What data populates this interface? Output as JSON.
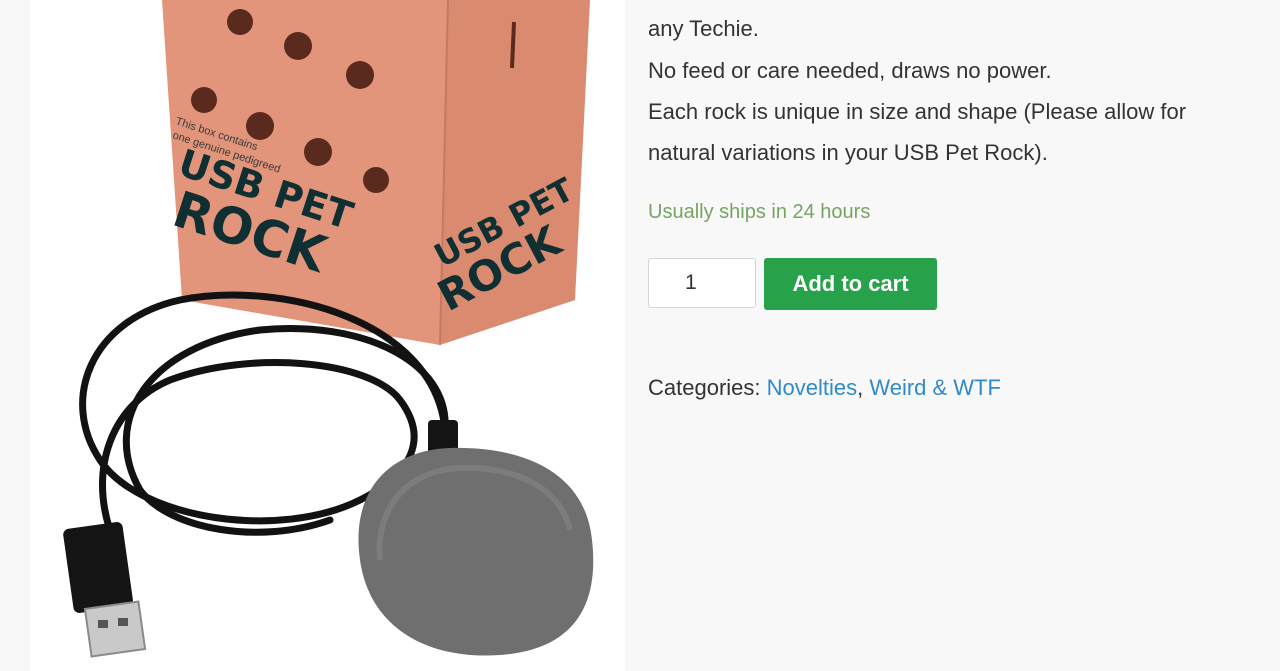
{
  "product": {
    "image_alt": "USB Pet Rock in its box",
    "box_text_line1": "USB PET",
    "box_text_line2": "ROCK",
    "box_small_text_1": "This box contains",
    "box_small_text_2": "one genuine pedigreed",
    "description_lines": [
      "any Techie.",
      "No feed or care needed, draws no power.",
      "Each rock is unique in size and shape (Please allow for",
      "natural variations in your USB Pet Rock)."
    ],
    "stock_text": "Usually ships in 24 hours",
    "quantity": "1",
    "add_to_cart_label": "Add to cart",
    "categories_label": "Categories:",
    "categories": [
      "Novelties",
      "Weird & WTF"
    ],
    "category_separator": ", "
  },
  "colors": {
    "stock": "#77a464",
    "button": "#28a24a",
    "link": "#2f8ac9",
    "box": "#e2957a"
  }
}
